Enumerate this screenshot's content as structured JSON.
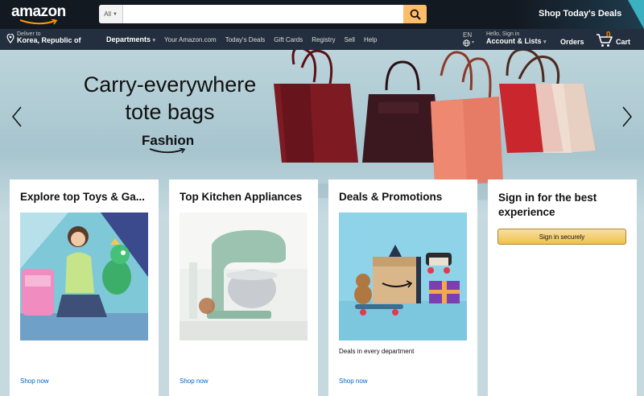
{
  "header": {
    "logo": "amazon",
    "search": {
      "category": "All",
      "value": "",
      "placeholder": ""
    },
    "promo": "Shop Today's Deals"
  },
  "subnav": {
    "deliver_label": "Deliver to",
    "deliver_location": "Korea, Republic of",
    "departments": "Departments",
    "links": [
      "Your Amazon.com",
      "Today's Deals",
      "Gift Cards",
      "Registry",
      "Sell",
      "Help"
    ],
    "language": "EN",
    "account_greeting": "Hello, Sign in",
    "account_lists": "Account & Lists",
    "orders": "Orders",
    "cart_count": "0",
    "cart_label": "Cart"
  },
  "hero": {
    "headline_1": "Carry-everywhere",
    "headline_2": "tote bags",
    "brand": "Fashion"
  },
  "cards": [
    {
      "title": "Explore top Toys & Ga...",
      "link": "Shop now"
    },
    {
      "title": "Top Kitchen Appliances",
      "link": "Shop now"
    },
    {
      "title": "Deals & Promotions",
      "subtitle": "Deals in every department",
      "link": "Shop now"
    }
  ],
  "signin": {
    "title": "Sign in for the best experience",
    "button": "Sign in securely"
  },
  "colors": {
    "nav_dark": "#131921",
    "nav_secondary": "#232f3e",
    "search_button": "#febd69",
    "cart_count": "#f08804",
    "link": "#0066c0",
    "signin_button": "#f0c14b"
  }
}
